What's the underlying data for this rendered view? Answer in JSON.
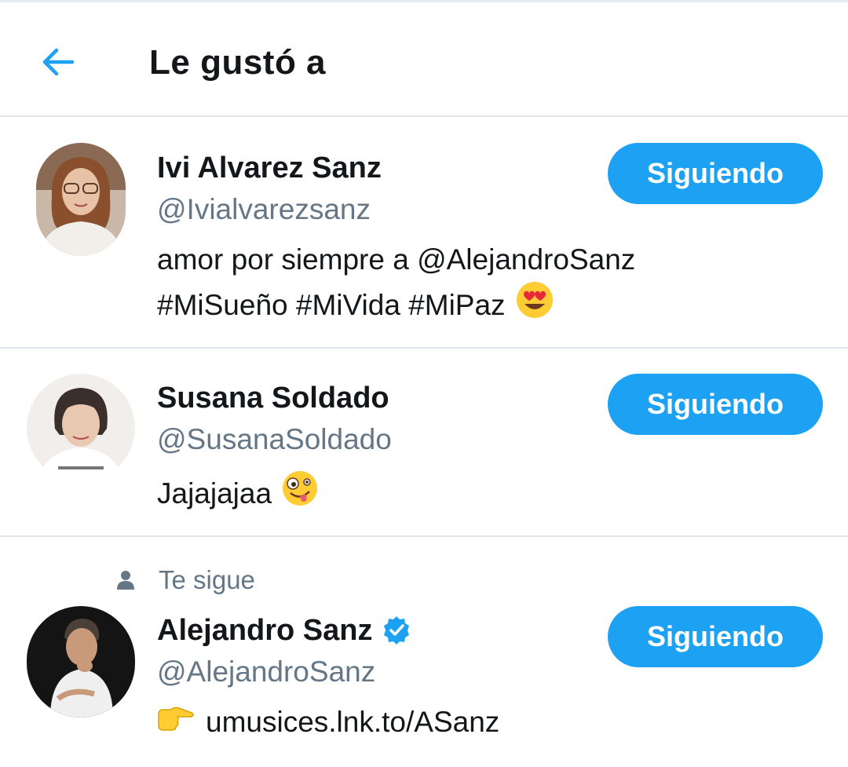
{
  "header": {
    "back_icon": "arrow-left-icon",
    "title": "Le gustó a"
  },
  "colors": {
    "accent": "#1da1f2",
    "text_primary": "#14171a",
    "text_secondary": "#657786",
    "divider": "#e1e8ed"
  },
  "users": [
    {
      "name": "Ivi Alvarez Sanz",
      "handle": "@Ivialvarezsanz",
      "bio_line1": "amor por siempre a @AlejandroSanz",
      "bio_line2": "#MiSueño #MiVida #MiPaz",
      "bio_emoji": "heart-eyes-emoji",
      "follow_label": "Siguiendo",
      "verified": false
    },
    {
      "name": "Susana Soldado",
      "handle": "@SusanaSoldado",
      "bio_line1": "Jajajajaa",
      "bio_emoji": "zany-face-emoji",
      "follow_label": "Siguiendo",
      "verified": false
    },
    {
      "follows_you": "Te sigue",
      "name": "Alejandro Sanz",
      "handle": "@AlejandroSanz",
      "bio_emoji": "pointing-right-emoji",
      "bio_line1": "umusices.lnk.to/ASanz",
      "follow_label": "Siguiendo",
      "verified": true
    }
  ]
}
